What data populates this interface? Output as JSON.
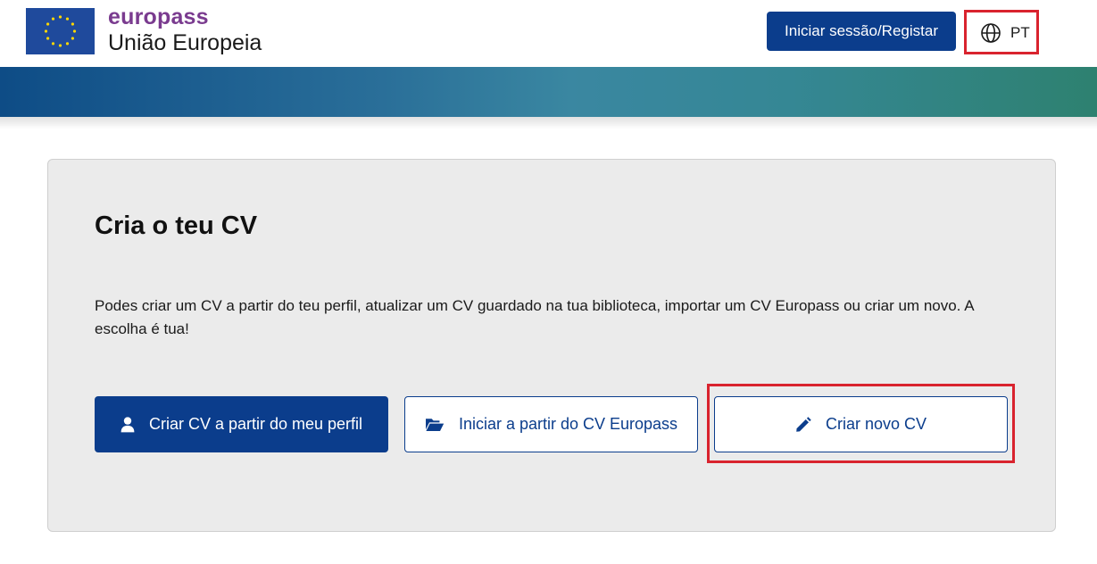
{
  "header": {
    "brand_name": "europass",
    "brand_org": "União Europeia",
    "login_label": "Iniciar sessão/Registar",
    "language_label": "PT",
    "language_icon": "globe-icon",
    "logo_icon": "eu-flag-icon"
  },
  "main": {
    "title": "Cria o teu CV",
    "description": "Podes criar um CV a partir do teu perfil, atualizar um CV guardado na tua biblioteca, importar um CV Europass ou criar um novo. A escolha é tua!",
    "actions": [
      {
        "label": "Criar CV a partir do meu perfil",
        "icon": "user-icon"
      },
      {
        "label": "Iniciar a partir do CV Europass",
        "icon": "folder-open-icon"
      },
      {
        "label": "Criar novo CV",
        "icon": "pencil-icon"
      }
    ]
  },
  "colors": {
    "primary": "#0b3d8c",
    "brand_purple": "#7a3b8f",
    "highlight_red": "#d9232e",
    "card_background": "#ebebeb",
    "flag_blue": "#1f4a9c",
    "flag_stars": "#ffd700"
  }
}
